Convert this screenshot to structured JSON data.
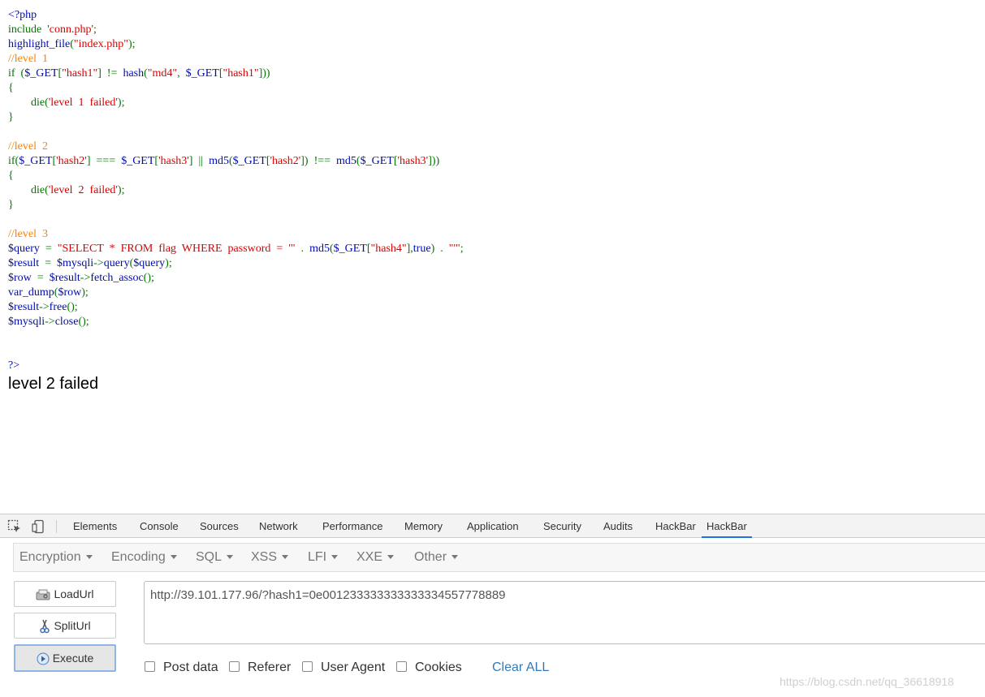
{
  "code_lines": [
    [
      {
        "t": "<?php",
        "c": "def"
      }
    ],
    [
      {
        "t": "include",
        "c": "kw"
      },
      {
        "t": "  ",
        "c": "kw"
      },
      {
        "t": "'conn.php'",
        "c": "str"
      },
      {
        "t": ";",
        "c": "kw"
      }
    ],
    [
      {
        "t": "highlight_file",
        "c": "def"
      },
      {
        "t": "(",
        "c": "kw"
      },
      {
        "t": "\"index.php\"",
        "c": "str"
      },
      {
        "t": ");",
        "c": "kw"
      }
    ],
    [
      {
        "t": "//level  1",
        "c": "cmt"
      }
    ],
    [
      {
        "t": "if  (",
        "c": "kw"
      },
      {
        "t": "$_GET",
        "c": "def"
      },
      {
        "t": "[",
        "c": "kw"
      },
      {
        "t": "\"hash1\"",
        "c": "str"
      },
      {
        "t": "]  !=  ",
        "c": "kw"
      },
      {
        "t": "hash",
        "c": "def"
      },
      {
        "t": "(",
        "c": "kw"
      },
      {
        "t": "\"md4\"",
        "c": "str"
      },
      {
        "t": ",  ",
        "c": "kw"
      },
      {
        "t": "$_GET",
        "c": "def"
      },
      {
        "t": "[",
        "c": "kw"
      },
      {
        "t": "\"hash1\"",
        "c": "str"
      },
      {
        "t": "]))",
        "c": "kw"
      }
    ],
    [
      {
        "t": "{",
        "c": "kw"
      }
    ],
    [
      {
        "t": "        die",
        "c": "kw"
      },
      {
        "t": "(",
        "c": "kw"
      },
      {
        "t": "'level  1  failed'",
        "c": "str"
      },
      {
        "t": ");",
        "c": "kw"
      }
    ],
    [
      {
        "t": "}",
        "c": "kw"
      }
    ],
    [],
    [
      {
        "t": "//level  2",
        "c": "cmt"
      }
    ],
    [
      {
        "t": "if(",
        "c": "kw"
      },
      {
        "t": "$_GET",
        "c": "def"
      },
      {
        "t": "[",
        "c": "kw"
      },
      {
        "t": "'hash2'",
        "c": "str"
      },
      {
        "t": "]  ===  ",
        "c": "kw"
      },
      {
        "t": "$_GET",
        "c": "def"
      },
      {
        "t": "[",
        "c": "kw"
      },
      {
        "t": "'hash3'",
        "c": "str"
      },
      {
        "t": "]  ||  ",
        "c": "kw"
      },
      {
        "t": "md5",
        "c": "def"
      },
      {
        "t": "(",
        "c": "kw"
      },
      {
        "t": "$_GET",
        "c": "def"
      },
      {
        "t": "[",
        "c": "kw"
      },
      {
        "t": "'hash2'",
        "c": "str"
      },
      {
        "t": "])  !==  ",
        "c": "kw"
      },
      {
        "t": "md5",
        "c": "def"
      },
      {
        "t": "(",
        "c": "kw"
      },
      {
        "t": "$_GET",
        "c": "def"
      },
      {
        "t": "[",
        "c": "kw"
      },
      {
        "t": "'hash3'",
        "c": "str"
      },
      {
        "t": "]))",
        "c": "kw"
      }
    ],
    [
      {
        "t": "{",
        "c": "kw"
      }
    ],
    [
      {
        "t": "        die",
        "c": "kw"
      },
      {
        "t": "(",
        "c": "kw"
      },
      {
        "t": "'level  2  failed'",
        "c": "str"
      },
      {
        "t": ");",
        "c": "kw"
      }
    ],
    [
      {
        "t": "}",
        "c": "kw"
      }
    ],
    [],
    [
      {
        "t": "//level  3",
        "c": "cmt"
      }
    ],
    [
      {
        "t": "$query",
        "c": "def"
      },
      {
        "t": "  =  ",
        "c": "kw"
      },
      {
        "t": "\"SELECT  *  FROM  flag  WHERE  password  =  '\"",
        "c": "str"
      },
      {
        "t": "  .  ",
        "c": "kw"
      },
      {
        "t": "md5",
        "c": "def"
      },
      {
        "t": "(",
        "c": "kw"
      },
      {
        "t": "$_GET",
        "c": "def"
      },
      {
        "t": "[",
        "c": "kw"
      },
      {
        "t": "\"hash4\"",
        "c": "str"
      },
      {
        "t": "],",
        "c": "kw"
      },
      {
        "t": "true",
        "c": "def"
      },
      {
        "t": ")  .  ",
        "c": "kw"
      },
      {
        "t": "\"'\"",
        "c": "str"
      },
      {
        "t": ";",
        "c": "kw"
      }
    ],
    [
      {
        "t": "$result",
        "c": "def"
      },
      {
        "t": "  =  ",
        "c": "kw"
      },
      {
        "t": "$mysqli",
        "c": "def"
      },
      {
        "t": "->",
        "c": "kw"
      },
      {
        "t": "query",
        "c": "def"
      },
      {
        "t": "(",
        "c": "kw"
      },
      {
        "t": "$query",
        "c": "def"
      },
      {
        "t": ");",
        "c": "kw"
      }
    ],
    [
      {
        "t": "$row",
        "c": "def"
      },
      {
        "t": "  =  ",
        "c": "kw"
      },
      {
        "t": "$result",
        "c": "def"
      },
      {
        "t": "->",
        "c": "kw"
      },
      {
        "t": "fetch_assoc",
        "c": "def"
      },
      {
        "t": "();",
        "c": "kw"
      }
    ],
    [
      {
        "t": "var_dump",
        "c": "def"
      },
      {
        "t": "(",
        "c": "kw"
      },
      {
        "t": "$row",
        "c": "def"
      },
      {
        "t": ");",
        "c": "kw"
      }
    ],
    [
      {
        "t": "$result",
        "c": "def"
      },
      {
        "t": "->",
        "c": "kw"
      },
      {
        "t": "free",
        "c": "def"
      },
      {
        "t": "();",
        "c": "kw"
      }
    ],
    [
      {
        "t": "$mysqli",
        "c": "def"
      },
      {
        "t": "->",
        "c": "kw"
      },
      {
        "t": "close",
        "c": "def"
      },
      {
        "t": "();",
        "c": "kw"
      }
    ],
    [],
    [],
    [
      {
        "t": "?>",
        "c": "def"
      }
    ]
  ],
  "output_text": "level 2 failed",
  "devtools": {
    "tabs": [
      {
        "label": "Elements"
      },
      {
        "label": "Console"
      },
      {
        "label": "Sources"
      },
      {
        "label": "Network"
      },
      {
        "label": "Performance"
      },
      {
        "label": "Memory"
      },
      {
        "label": "Application"
      },
      {
        "label": "Security"
      },
      {
        "label": "Audits"
      },
      {
        "label": "HackBar"
      },
      {
        "label": "HackBar"
      }
    ],
    "active_tab_index": 10
  },
  "hackbar": {
    "menu": [
      "Encoding",
      "SQL",
      "XSS",
      "LFI",
      "XXE",
      "Other"
    ],
    "menu_first": "Encryption",
    "buttons": {
      "load": "LoadUrl",
      "split": "SplitUrl",
      "execute": "Execute"
    },
    "url_value": "http://39.101.177.96/?hash1=0e001233333333333334557778889",
    "options": [
      "Post data",
      "Referer",
      "User Agent",
      "Cookies"
    ],
    "clear_all": "Clear ALL"
  },
  "watermark": "https://blog.csdn.net/qq_36618918",
  "colors": {
    "php_default": "#000bb0",
    "php_keyword": "#007700",
    "php_string": "#dd0000",
    "php_comment": "#ff8000",
    "active_tab_underline": "#1a73e8",
    "link": "#337ab7"
  }
}
